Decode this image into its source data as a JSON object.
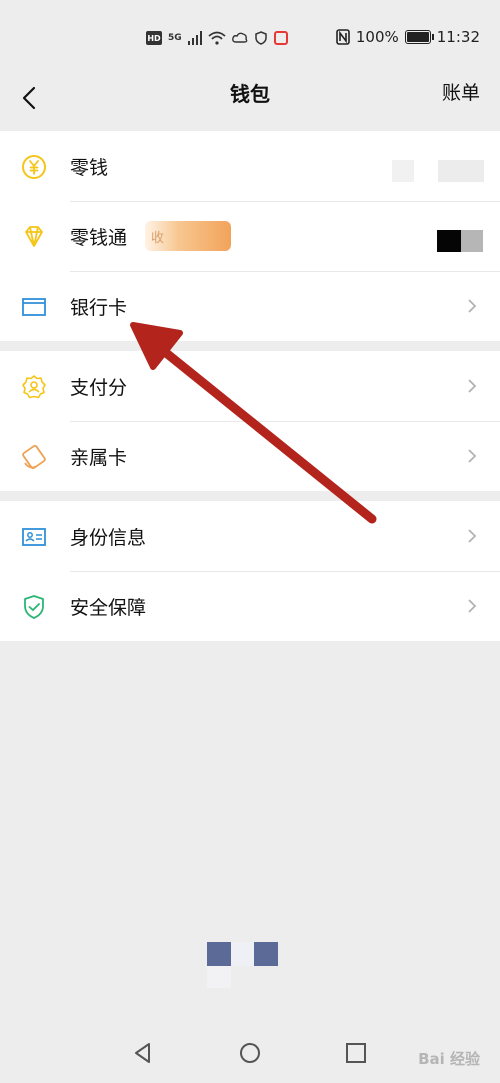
{
  "status_bar": {
    "hd": "HD",
    "network": "5G",
    "battery_percent": "100%",
    "time": "11:32"
  },
  "navbar": {
    "title": "钱包",
    "right_link": "账单",
    "back_icon": "chevron-left-icon"
  },
  "groups": [
    {
      "items": [
        {
          "label": "零钱",
          "icon": "yuan-coin-icon",
          "color": "#f5c518"
        },
        {
          "label": "零钱通",
          "icon": "diamond-icon",
          "color": "#f5c518",
          "tag": "收"
        },
        {
          "label": "银行卡",
          "icon": "card-icon",
          "color": "#2f8fd8"
        }
      ]
    },
    {
      "items": [
        {
          "label": "支付分",
          "icon": "badge-score-icon",
          "color": "#f5c518"
        },
        {
          "label": "亲属卡",
          "icon": "family-card-icon",
          "color": "#f0a050"
        }
      ]
    },
    {
      "items": [
        {
          "label": "身份信息",
          "icon": "id-card-icon",
          "color": "#2f8fd8"
        },
        {
          "label": "安全保障",
          "icon": "shield-check-icon",
          "color": "#2bb673"
        }
      ]
    }
  ],
  "watermark": "Bai 经验",
  "colors": {
    "background": "#ededed",
    "annotation_arrow": "#b3241d"
  }
}
